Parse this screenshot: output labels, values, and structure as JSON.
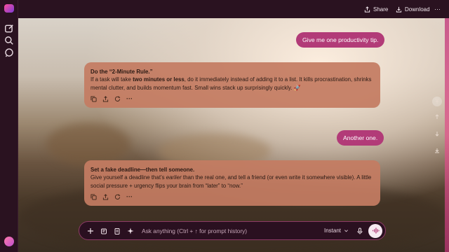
{
  "header": {
    "share_label": "Share",
    "download_label": "Download",
    "more_label": "···"
  },
  "avatar_initials": "",
  "messages": [
    {
      "role": "user",
      "text": "Give me one productivity tip."
    },
    {
      "role": "assistant",
      "title": "Do the “2-Minute Rule.”",
      "body_pre": "If a task will take ",
      "body_bold": "two minutes or less",
      "body_post": ", do it immediately instead of adding it to a list. It kills procrastination, shrinks mental clutter, and builds momentum fast. Small wins stack up surprisingly quickly. 🚀"
    },
    {
      "role": "user",
      "text": "Another one."
    },
    {
      "role": "assistant",
      "title": "Set a fake deadline—then tell someone.",
      "body_pre": "Give yourself a deadline that’s ",
      "body_em": "earlier",
      "body_post": " than the real one, and tell a friend (or even write it somewhere visible). A little social pressure + urgency flips your brain from “later” to “now.”"
    }
  ],
  "composer": {
    "placeholder": "Ask anything (Ctrl + ↑ for prompt history)",
    "mode_label": "Instant"
  },
  "colors": {
    "accent": "#b23b78",
    "card": "#c47c62",
    "chrome": "#2a1220"
  }
}
